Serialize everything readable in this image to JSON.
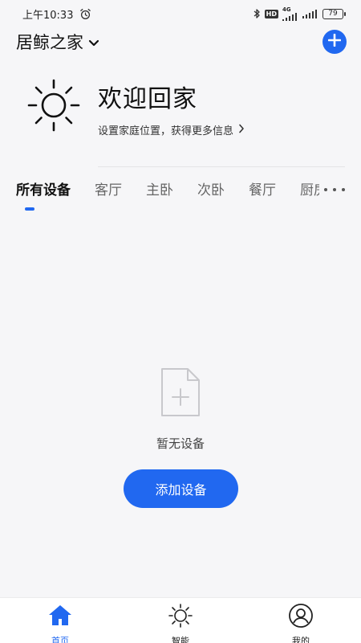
{
  "status_bar": {
    "time": "上午10:33",
    "hd_label": "HD",
    "network_label": "4G",
    "battery": "79",
    "icons": [
      "alarm-icon",
      "bluetooth-icon",
      "hd-icon",
      "signal-icon",
      "signal-icon",
      "battery-icon"
    ]
  },
  "header": {
    "home_name": "居鲸之家",
    "icons": [
      "chevron-down-icon",
      "plus-icon"
    ]
  },
  "welcome": {
    "title": "欢迎回家",
    "subtitle": "设置家庭位置，获得更多信息",
    "icons": [
      "sun-icon",
      "chevron-right-icon"
    ]
  },
  "tabs": {
    "items": [
      {
        "label": "所有设备",
        "active": true
      },
      {
        "label": "客厅",
        "active": false
      },
      {
        "label": "主卧",
        "active": false
      },
      {
        "label": "次卧",
        "active": false
      },
      {
        "label": "餐厅",
        "active": false
      },
      {
        "label": "厨房",
        "active": false
      }
    ],
    "more_icon": "more-icon"
  },
  "empty_state": {
    "icon": "file-add-icon",
    "text": "暂无设备",
    "button_label": "添加设备"
  },
  "bottom_nav": {
    "items": [
      {
        "label": "首页",
        "icon": "home-icon",
        "active": true
      },
      {
        "label": "智能",
        "icon": "sun-icon",
        "active": false
      },
      {
        "label": "我的",
        "icon": "user-icon",
        "active": false
      }
    ]
  },
  "colors": {
    "accent": "#2168f0",
    "background": "#f6f6f8",
    "text_primary": "#111111",
    "text_secondary": "#666666"
  }
}
